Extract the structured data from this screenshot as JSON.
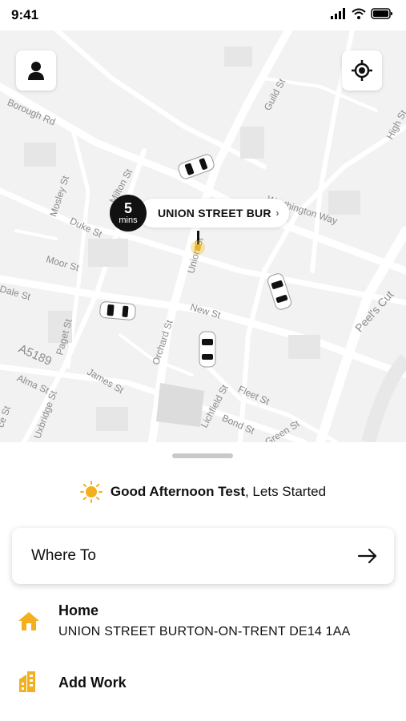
{
  "status_bar": {
    "time": "9:41"
  },
  "map": {
    "street_labels": [
      "Borough Rd",
      "Guild St",
      "High St",
      "Mosley St",
      "Milton St",
      "Duke St",
      "Moor St",
      "Dale St",
      "Paget St",
      "A5189",
      "Alma St",
      "James St",
      "Orchard St",
      "Union St",
      "Uxbridge St",
      "New St",
      "Lichfield St",
      "Fleet St",
      "Bond St",
      "Green St",
      "Peel's Cut",
      "Worthington Way",
      "ce St"
    ],
    "pickup": {
      "eta_value": "5",
      "eta_unit": "mins",
      "label": "UNION STREET BUR"
    }
  },
  "greeting": {
    "name": "Good Afternoon Test",
    "suffix": ", Lets Started"
  },
  "search": {
    "label": "Where To"
  },
  "saved_places": [
    {
      "title": "Home",
      "address": "UNION STREET BURTON-ON-TRENT DE14 1AA",
      "icon": "home-icon"
    },
    {
      "title": "Add Work",
      "icon": "work-building-icon"
    }
  ],
  "colors": {
    "accent": "#f2b01e",
    "dark": "#111111",
    "map_bg": "#f2f2f2"
  }
}
